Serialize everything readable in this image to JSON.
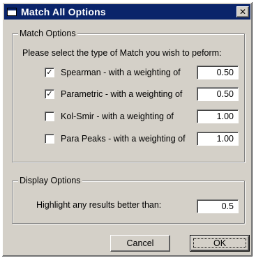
{
  "window": {
    "title": "Match All Options",
    "close_glyph": "✕",
    "icon": "app-window-icon"
  },
  "match_options": {
    "legend": "Match Options",
    "prompt": "Please select the type of Match you wish to peform:",
    "items": [
      {
        "label": "Spearman - with a weighting of",
        "checked": true,
        "weight": "0.50"
      },
      {
        "label": "Parametric - with a weighting of",
        "checked": true,
        "weight": "0.50"
      },
      {
        "label": "Kol-Smir - with a weighting of",
        "checked": false,
        "weight": "1.00"
      },
      {
        "label": "Para Peaks - with a weighting of",
        "checked": false,
        "weight": "1.00"
      }
    ]
  },
  "display_options": {
    "legend": "Display Options",
    "highlight_label": "Highlight any results  better than:",
    "highlight_value": "0.5"
  },
  "buttons": {
    "cancel": "Cancel",
    "ok": "OK"
  },
  "check_glyph": "✓"
}
